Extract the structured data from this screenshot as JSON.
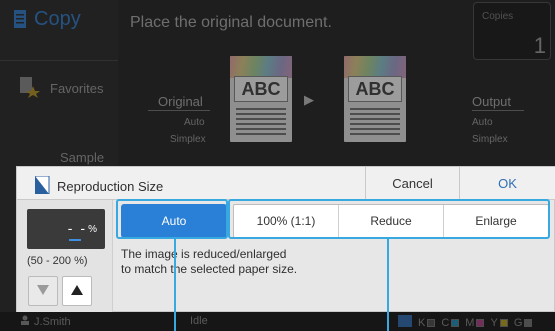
{
  "app": {
    "title": "Copy",
    "message": "Place the original document.",
    "copies_label": "Copies",
    "copies_value": "1"
  },
  "sidebar": {
    "favorites_label": "Favorites",
    "sample_label": "Sample"
  },
  "preview": {
    "original_label": "Original",
    "original_line1": "Auto",
    "original_line2": "Simplex",
    "output_label": "Output",
    "output_line1": "Auto",
    "output_line2": "Simplex",
    "doc_text": "ABC"
  },
  "dialog": {
    "title": "Reproduction Size",
    "cancel_label": "Cancel",
    "ok_label": "OK",
    "value_display": "- -",
    "value_unit": "%",
    "range_text": "(50 - 200 %)",
    "options": [
      {
        "label": "Auto",
        "selected": true
      },
      {
        "label": "100% (1:1)",
        "selected": false
      },
      {
        "label": "Reduce",
        "selected": false
      },
      {
        "label": "Enlarge",
        "selected": false
      }
    ],
    "description_line1": "The image is reduced/enlarged",
    "description_line2": "to match the selected paper size."
  },
  "statusbar": {
    "user": "J.Smith",
    "status": "Idle",
    "ink_labels": [
      "K",
      "C",
      "M",
      "Y",
      "G"
    ]
  },
  "colors": {
    "accent": "#2a7fd6",
    "callout": "#38a8e0"
  }
}
